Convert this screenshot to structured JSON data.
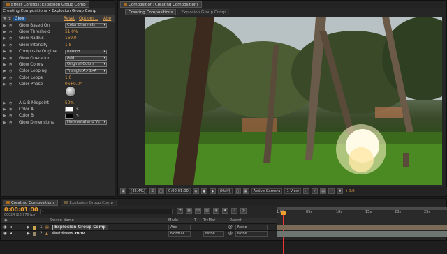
{
  "effect_panel": {
    "tab_label": "Effect Controls: Explosion Group Comp",
    "breadcrumb": "Creating Compositions • Explosion Group Comp",
    "effect_name": "Glow",
    "reset": "Reset",
    "options": "Options...",
    "about": "Abo",
    "rows": [
      {
        "name": "Glow Based On",
        "type": "select",
        "value": "Color Channels"
      },
      {
        "name": "Glow Threshold",
        "type": "value",
        "value": "51.0%"
      },
      {
        "name": "Glow Radius",
        "type": "value",
        "value": "169.0"
      },
      {
        "name": "Glow Intensity",
        "type": "value",
        "value": "1.8"
      },
      {
        "name": "Composite Original",
        "type": "select",
        "value": "Behind"
      },
      {
        "name": "Glow Operation",
        "type": "select",
        "value": "Add"
      },
      {
        "name": "Glow Colors",
        "type": "select",
        "value": "Original Colors"
      },
      {
        "name": "Color Looping",
        "type": "select",
        "value": "Triangle A>B>A"
      },
      {
        "name": "Color Loops",
        "type": "value",
        "value": "1.0"
      },
      {
        "name": "Color Phase",
        "type": "value",
        "value": "0x+0.0°"
      }
    ],
    "rows2": [
      {
        "name": "A & B Midpoint",
        "type": "value",
        "value": "50%"
      },
      {
        "name": "Color A",
        "type": "color",
        "value": ""
      },
      {
        "name": "Color B",
        "type": "color",
        "value": ""
      },
      {
        "name": "Glow Dimensions",
        "type": "select",
        "value": "Horizontal and Ve"
      }
    ]
  },
  "comp_panel": {
    "tab_label": "Composition: Creating Compositions",
    "subtab1": "Creating Compositions",
    "subtab2": "Explosion Group Comp",
    "footer": {
      "zoom": "(42.4%)",
      "timecode": "0:00:01:00",
      "resolution": "(Half)",
      "camera": "Active Camera",
      "view": "1 View",
      "exposure": "+0.0"
    }
  },
  "timeline": {
    "tab_active": "Creating Compositions",
    "tab_other": "Explosion Group Comp",
    "timecode": "0:00:01:00",
    "frame_info": "00024 (23.976 fps)",
    "search_placeholder": "",
    "headers": {
      "source_name": "Source Name",
      "mode": "Mode",
      "t": "T",
      "trkmat": "TrkMat",
      "parent": "Parent"
    },
    "ruler": [
      "1:00s",
      "05s",
      "10s",
      "15s",
      "20s",
      "25s"
    ],
    "layers": [
      {
        "num": "1",
        "name": "Explosion Group Comp",
        "mode": "Add",
        "trkmat": "",
        "parent": "None"
      },
      {
        "num": "2",
        "name": "Outdoors.mov",
        "mode": "Normal",
        "trkmat": "None",
        "parent": "None"
      }
    ]
  },
  "colors": {
    "accent": "#e6a24a",
    "timecode": "#f0a030",
    "layer_bar": "#7b6b56",
    "layer_bar2": "#6d7670"
  }
}
